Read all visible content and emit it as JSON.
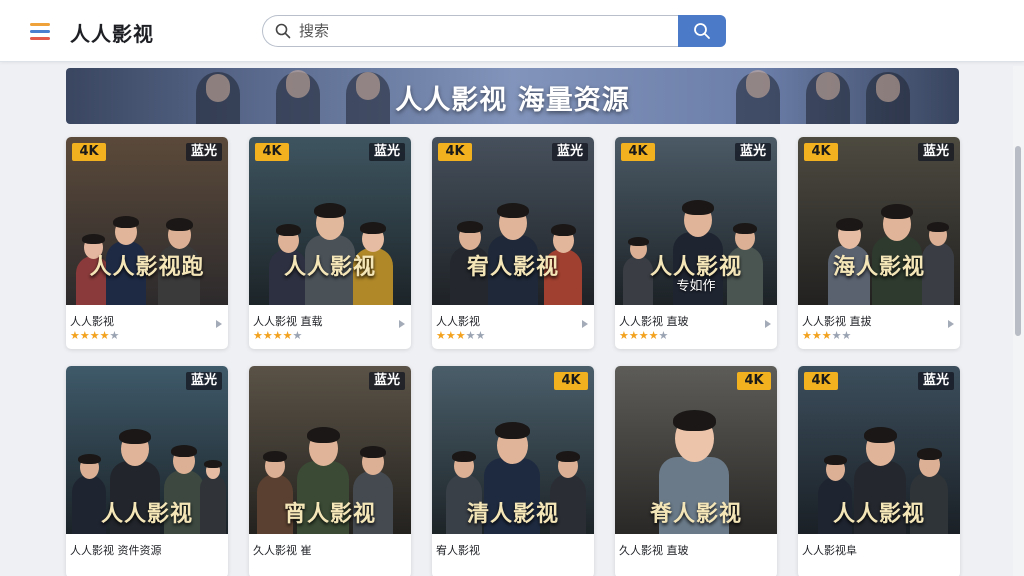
{
  "header": {
    "logo": "人人影视",
    "search_placeholder": "搜索"
  },
  "banner": {
    "title": "人人影视 海量资源"
  },
  "colors": {
    "accent": "#4a7ac8",
    "badge_4k": "#f2b11e",
    "star": "#f2a21e"
  },
  "cards": [
    {
      "badge_left": "4K",
      "badge_right": "蓝光",
      "poster_title": "人人影视跑",
      "poster_sub": "",
      "caption": "人人影视",
      "rating": 4
    },
    {
      "badge_left": "4K",
      "badge_right": "蓝光",
      "poster_title": "人人影视",
      "poster_sub": "",
      "caption": "人人影视 直载",
      "rating": 4
    },
    {
      "badge_left": "4K",
      "badge_right": "蓝光",
      "poster_title": "宥人影视",
      "poster_sub": "",
      "caption": "人人影视",
      "rating": 3
    },
    {
      "badge_left": "4K",
      "badge_right": "蓝光",
      "poster_title": "人人影视",
      "poster_sub": "专如作",
      "caption": "人人影视 直玻",
      "rating": 4
    },
    {
      "badge_left": "4K",
      "badge_right": "蓝光",
      "poster_title": "海人影视",
      "poster_sub": "",
      "caption": "人人影视 直拔",
      "rating": 3
    },
    {
      "badge_left": "",
      "badge_right": "蓝光",
      "poster_title": "人人影视",
      "poster_sub": "",
      "caption": "人人影视 资件资源",
      "rating": 0
    },
    {
      "badge_left": "",
      "badge_right": "蓝光",
      "poster_title": "宵人影视",
      "poster_sub": "",
      "caption": "久人影视 崔",
      "rating": 0
    },
    {
      "badge_left": "",
      "badge_right": "4K",
      "poster_title": "清人影视",
      "poster_sub": "",
      "caption": "宥人影视",
      "rating": 0
    },
    {
      "badge_left": "",
      "badge_right": "4K",
      "poster_title": "脊人影视",
      "poster_sub": "",
      "caption": "久人影视 直玻",
      "rating": 0
    },
    {
      "badge_left": "4K",
      "badge_right": "蓝光",
      "poster_title": "人人影视",
      "poster_sub": "",
      "caption": "人人影视阜",
      "rating": 0
    }
  ]
}
